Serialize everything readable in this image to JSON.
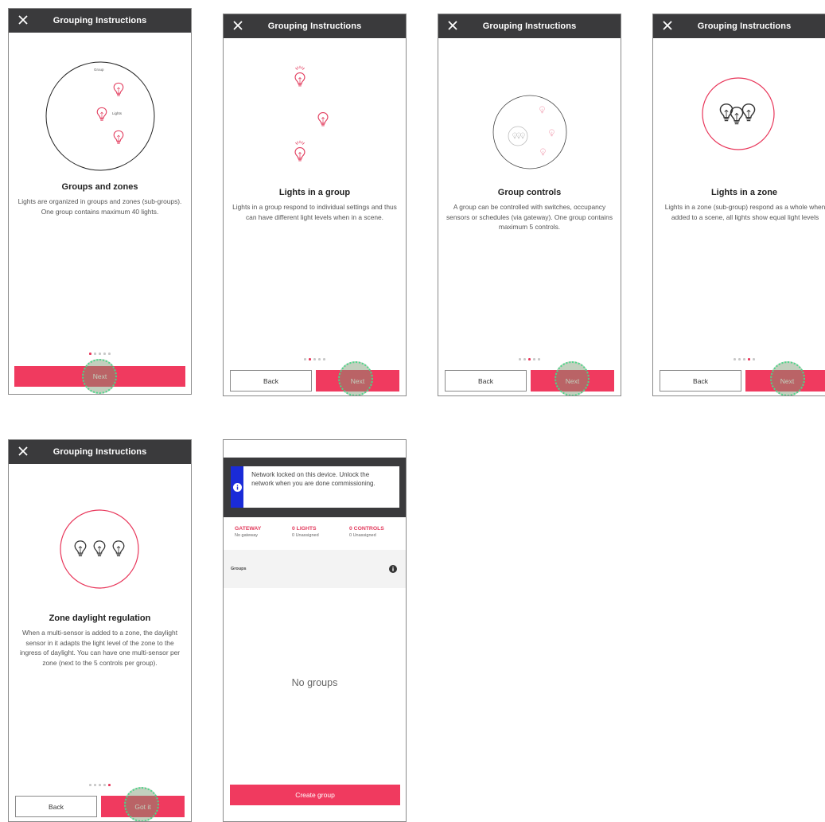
{
  "colors": {
    "accent": "#f03a5f",
    "titlebar": "#3a3a3c",
    "info": "#1a2bd8",
    "tap": "#4cd68a"
  },
  "icons": {
    "close": "close-icon",
    "bulb": "light-bulb-icon",
    "info": "info-icon"
  },
  "screens": [
    {
      "title": "Grouping Instructions",
      "heading": "Groups and zones",
      "body": "Lights are organized in groups and zones (sub-groups). One group contains maximum 40 lights.",
      "next": "Next",
      "labels": {
        "group": "Group",
        "lights": "Lights"
      },
      "active_dot": 0
    },
    {
      "title": "Grouping Instructions",
      "heading": "Lights in a group",
      "body": "Lights in a group respond to individual settings and thus can have different light levels when in a scene.",
      "back": "Back",
      "next": "Next",
      "active_dot": 1
    },
    {
      "title": "Grouping Instructions",
      "heading": "Group controls",
      "body": "A group can be controlled with switches, occupancy sensors or schedules (via gateway). One group contains maximum 5 controls.",
      "back": "Back",
      "next": "Next",
      "active_dot": 2
    },
    {
      "title": "Grouping Instructions",
      "heading": "Lights in a zone",
      "body": "Lights in a zone (sub-group) respond as a whole when added to a scene, all lights show equal light levels",
      "back": "Back",
      "next": "Next",
      "active_dot": 3
    },
    {
      "title": "Grouping Instructions",
      "heading": "Zone daylight regulation",
      "body": "When a multi-sensor is added to a zone, the daylight sensor in it adapts the light level of the zone to the ingress of daylight. You can have one multi-sensor per zone (next to the 5 controls per group).",
      "back": "Back",
      "next": "Got it",
      "active_dot": 4
    }
  ],
  "home": {
    "notice": "Network locked on this device. Unlock the network when you are done commissioning.",
    "stats": [
      {
        "label": "GATEWAY",
        "sub": "No gateway"
      },
      {
        "label": "0 LIGHTS",
        "sub": "0 Unassigned"
      },
      {
        "label": "0 CONTROLS",
        "sub": "0 Unassigned"
      }
    ],
    "groups_label": "Groups",
    "empty": "No groups",
    "create": "Create group"
  }
}
